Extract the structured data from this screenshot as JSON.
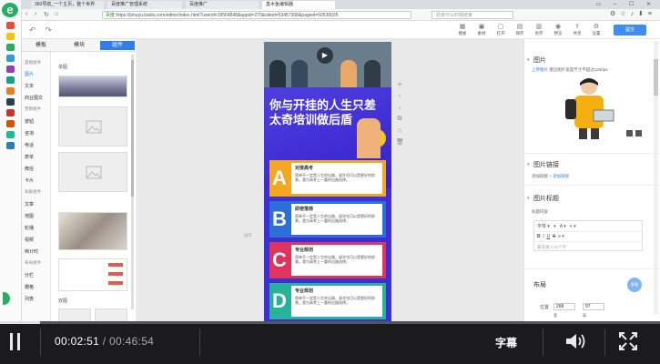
{
  "browser": {
    "tabs": [
      "360导航_一个主页，整个世界",
      "百度推广管理系统",
      "百度推广",
      "基木鱼编辑器"
    ],
    "url_prefix": "百度",
    "url": "https://jimuyu.baidu.com/editor/index.html?userid=19564848&appid=270&siteid=53457308&pageid=50530035",
    "search_placeholder": "抗疫什么时候结束"
  },
  "toolbar": {
    "items": [
      "模板",
      "素材",
      "打开",
      "保存",
      "另存",
      "预览",
      "共享",
      "设置"
    ],
    "submit": "提交"
  },
  "left_panel": {
    "tabs": [
      "模板",
      "模块",
      "组件"
    ],
    "categories": [
      "基础组件",
      "图片",
      "文本",
      "商业图文",
      "营销组件",
      "按钮",
      "咨询",
      "电话",
      "表单",
      "微信",
      "卡片",
      "高级组件",
      "文章",
      "地图",
      "轮播",
      "视频",
      "倒计时",
      "布局组件",
      "分栏",
      "栅格",
      "列表"
    ],
    "section_single": "单图",
    "section_double": "双图"
  },
  "page": {
    "headline": "你与开挂的人生只差\n太奇培训做后盾",
    "cards": [
      {
        "letter": "A",
        "title": "对接高考",
        "desc": "简单不一定是人生的出路，留学也可以是更好的前景。我为高考上一重的出路选择。",
        "color": "#f5a623"
      },
      {
        "letter": "B",
        "title": "即使落榜",
        "desc": "简单不一定是人生的出路，留学也可以是更好的前景。我为高考上一重的出路选择。",
        "color": "#2d6fd6"
      },
      {
        "letter": "C",
        "title": "专业规划",
        "desc": "简单不一定是人生的出路，留学也可以是更好的前景。我为高考上一重的出路选择。",
        "color": "#e0335e"
      },
      {
        "letter": "D",
        "title": "专业规划",
        "desc": "简单不一定是人生的出路，留学也可以是更好的前景。我为高考上一重的出路选择。",
        "color": "#27b39a"
      }
    ],
    "canvas_label": "画布"
  },
  "right_panel": {
    "image_title": "图片",
    "upload_hint_prefix": "上传图片",
    "upload_hint": "建议图片宽度尺寸不超过1200px",
    "link_title": "图片链接",
    "link_label": "添加链接",
    "link_action": "+ 添加链接",
    "caption_title": "图片标题",
    "caption_label": "标题内容",
    "font_label": "字体",
    "editor_placeholder": "最多输入20个字",
    "layout_title": "布局",
    "pos_label": "位置",
    "pos_x": "268",
    "pos_y": "97",
    "size_w_label": "宽",
    "size_h_label": "高",
    "badge": "客服"
  },
  "player": {
    "current_time": "00:02:51",
    "total_time": "/ 00:46:54",
    "subtitle_label": "字幕",
    "progress": 0.061
  }
}
